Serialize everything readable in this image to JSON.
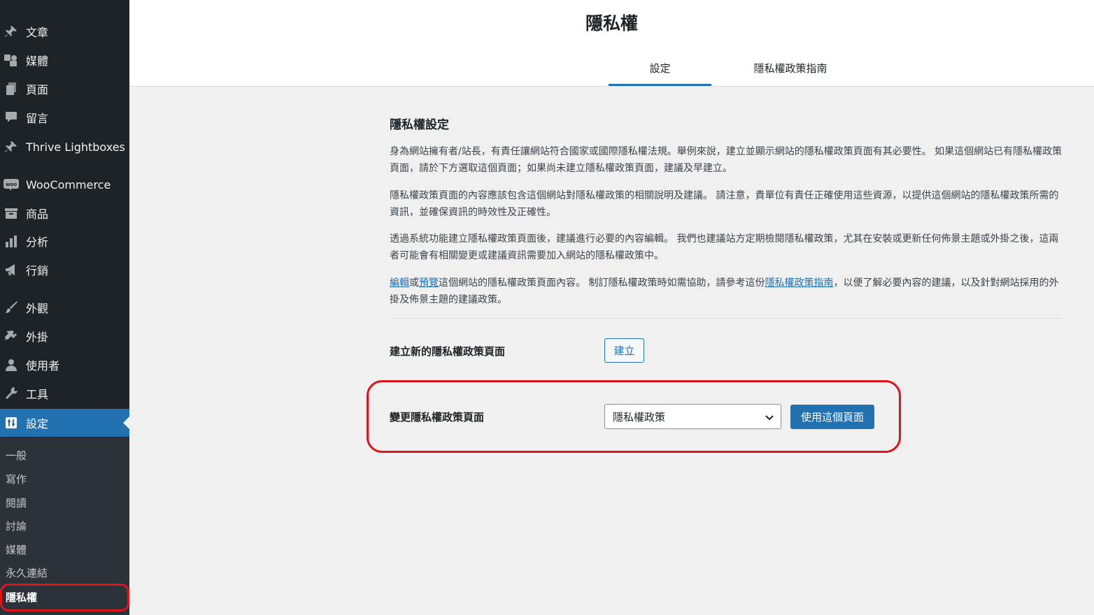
{
  "sidebar": {
    "items": [
      {
        "label": "文章",
        "icon": "pushpin-icon"
      },
      {
        "label": "媒體",
        "icon": "media-icon"
      },
      {
        "label": "頁面",
        "icon": "page-icon"
      },
      {
        "label": "留言",
        "icon": "comment-icon"
      },
      {
        "label": "Thrive Lightboxes",
        "icon": "pushpin-icon"
      },
      {
        "label": "WooCommerce",
        "icon": "woocommerce-icon"
      },
      {
        "label": "商品",
        "icon": "archive-icon"
      },
      {
        "label": "分析",
        "icon": "bar-chart-icon"
      },
      {
        "label": "行銷",
        "icon": "megaphone-icon"
      },
      {
        "label": "外觀",
        "icon": "paintbrush-icon"
      },
      {
        "label": "外掛",
        "icon": "plugin-icon"
      },
      {
        "label": "使用者",
        "icon": "user-icon"
      },
      {
        "label": "工具",
        "icon": "wrench-icon"
      },
      {
        "label": "設定",
        "icon": "settings-icon",
        "active": true
      }
    ],
    "submenu": [
      "一般",
      "寫作",
      "閱讀",
      "討論",
      "媒體",
      "永久連結",
      "隱私權"
    ],
    "submenu_current": "隱私權"
  },
  "header": {
    "title": "隱私權",
    "tabs": [
      {
        "label": "設定",
        "active": true
      },
      {
        "label": "隱私權政策指南",
        "active": false
      }
    ]
  },
  "main": {
    "section_title": "隱私權設定",
    "para1": "身為網站擁有者/站長，有責任讓網站符合國家或國際隱私權法規。舉例來說，建立並顯示網站的隱私權政策頁面有其必要性。 如果這個網站已有隱私權政策頁面，請於下方選取這個頁面；如果尚未建立隱私權政策頁面，建議及早建立。",
    "para2": "隱私權政策頁面的內容應該包含這個網站對隱私權政策的相關說明及建議。 請注意，貴單位有責任正確使用這些資源，以提供這個網站的隱私權政策所需的資訊，並確保資訊的時效性及正確性。",
    "para3": "透過系統功能建立隱私權政策頁面後，建議進行必要的內容編輯。 我們也建議站方定期檢閱隱私權政策，尤其在安裝或更新任何佈景主題或外掛之後，這兩者可能會有相關變更或建議資訊需要加入網站的隱私權政策中。",
    "para4": {
      "edit_link": "編輯",
      "or": "或",
      "preview_link": "預覽",
      "text1": "這個網站的隱私權政策頁面內容。 制訂隱私權政策時如需協助，請參考這份",
      "guide_link": "隱私權政策指南",
      "text2": "，以便了解必要內容的建議，以及針對網站採用的外掛及佈景主題的建議政策。"
    },
    "create_label": "建立新的隱私權政策頁面",
    "create_button": "建立",
    "change_label": "變更隱私權政策頁面",
    "select_value": "隱私權政策",
    "use_button": "使用這個頁面"
  },
  "colors": {
    "sidebar_bg": "#1d2327",
    "submenu_bg": "#2c3338",
    "accent": "#2271b1",
    "highlight_red": "#e0121c"
  }
}
